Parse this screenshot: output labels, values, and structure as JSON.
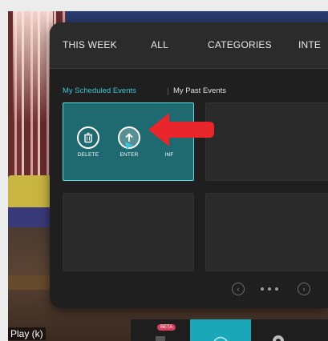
{
  "top_tabs": {
    "this_week": "THIS WEEK",
    "all": "ALL",
    "categories": "CATEGORIES",
    "interests": "INTE"
  },
  "sub_tabs": {
    "scheduled": "My Scheduled Events",
    "past": "My Past Events"
  },
  "selected_event": {
    "actions": {
      "delete": "DELETE",
      "enter": "ENTER",
      "info": "INF"
    }
  },
  "dock": {
    "beta_badge": "BETA"
  },
  "video_overlay": {
    "play_label": "Play (k)"
  },
  "colors": {
    "accent": "#3fc6da",
    "selected_card": "#1f6a70",
    "arrow": "#e8262b",
    "panel": "#1f1f20"
  }
}
